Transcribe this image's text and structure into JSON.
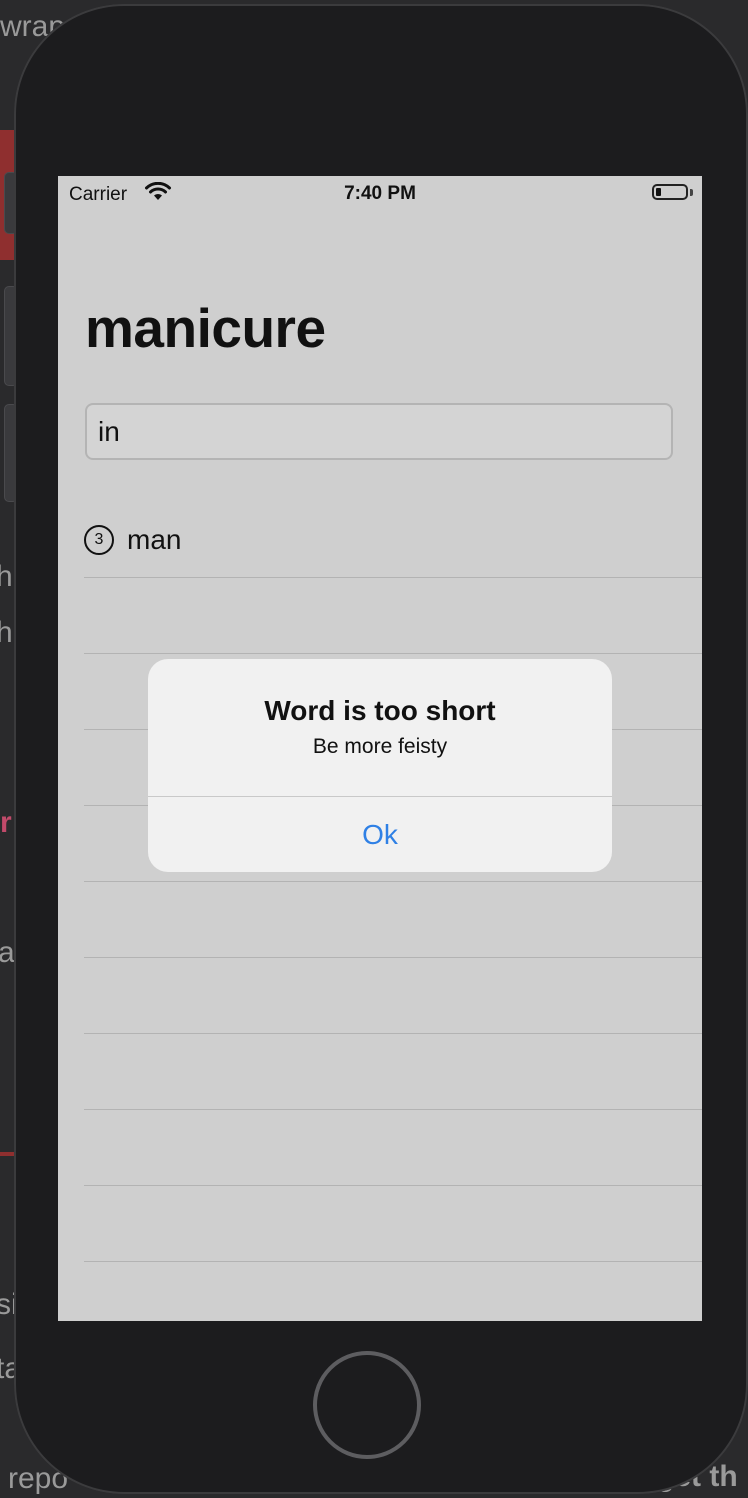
{
  "status_bar": {
    "carrier": "Carrier",
    "time": "7:40 PM"
  },
  "app": {
    "root_word": "manicure",
    "input_value": "in",
    "used_words": [
      {
        "length": "3",
        "word": "man"
      }
    ]
  },
  "alert": {
    "title": "Word is too short",
    "message": "Be more feisty",
    "button": "Ok"
  },
  "background_editor": {
    "fragments": [
      "wrap",
      "h",
      "h",
      "r",
      "a",
      "si",
      "ta",
      "repo",
      "get th"
    ]
  },
  "colors": {
    "screen_bg": "#cfcfcf",
    "alert_bg": "#f1f1f1",
    "alert_button": "#2f80e5",
    "device_body": "#1c1c1e"
  }
}
